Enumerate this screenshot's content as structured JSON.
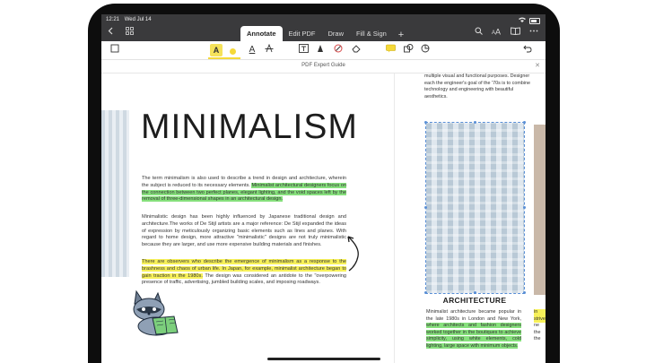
{
  "status": {
    "time": "12:21",
    "date": "Wed Jul 14"
  },
  "tabs": [
    {
      "label": "Annotate",
      "active": true
    },
    {
      "label": "Edit PDF",
      "active": false
    },
    {
      "label": "Draw",
      "active": false
    },
    {
      "label": "Fill & Sign",
      "active": false
    }
  ],
  "nav_icons": [
    "back-icon",
    "grid-icon",
    "add-tab-icon",
    "search-icon",
    "text-size-icon",
    "reader-icon",
    "more-icon"
  ],
  "toolbar_icons": [
    "select-icon",
    "highlight-icon",
    "color-dot-icon",
    "underline-text-icon",
    "strikeout-icon",
    "textbox-icon",
    "pen-icon",
    "stamp-icon",
    "eraser-icon",
    "comment-icon",
    "shapes-icon",
    "sticker-icon",
    "undo-icon"
  ],
  "toolbar": {
    "highlight_label": "A",
    "underline_label": "A"
  },
  "document": {
    "title": "PDF Expert Guide"
  },
  "left_page": {
    "title": "MINIMALISM",
    "para1": {
      "before": "The term minimalism is also used to describe a trend in design and architecture, wherein the subject is reduced to its necessary elements.",
      "highlight_green": "Minimalist architectural designers focus on the connection between two perfect planes, elegant lighting, and the void spaces left by the removal of three-dimensional shapes in an architectural design."
    },
    "para2": "Minimalistic design has been highly influenced by Japanese traditional design and architecture.The works of De Stijl artists are a major reference: De Stijl expanded the ideas of expression by meticulously organizing basic elements such as lines and planes. With regard to home design, more attractive \"minimalistic\" designs are not truly minimalistic because they are larger, and use more expensive building materials and finishes.",
    "para3": {
      "highlight_yellow": "There are observers who describe the emergence of minimalism as a response to the brashness and chaos of urban life. In Japan, for example, minimalist architecture began to gain traction in the 1980s.",
      "after": "The design was considered an antidote to the \"overpowering presence of traffic, advertising, jumbled building scales, and imposing roadways."
    }
  },
  "right_page": {
    "top_text": "multiple visual and functional purposes. Designer each the engineer's goal of the '70s is to combine technology and engineering with beautiful aesthetics.",
    "heading": "ARCHITECTURE",
    "para_before": "Minimalist architecture became popular in the late 1980s in London and New York,",
    "para_highlight": "where architects and fashion designers worked together in the boutiques to achieve simplicity, using white elements, cold lighting, large space with minimum objects.",
    "edge_lines": [
      "in",
      "strive",
      "ne",
      "the",
      "the"
    ]
  }
}
